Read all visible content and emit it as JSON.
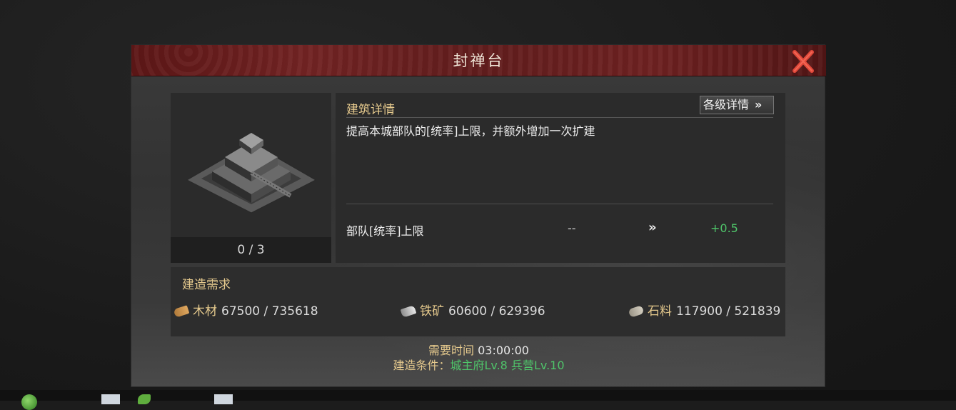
{
  "dialog": {
    "title": "封禅台",
    "close_icon": "close-x-icon",
    "colors": {
      "header_red": "#6e2222",
      "close_red": "#d94a3c",
      "gold_text": "#e5c98d",
      "green_text": "#4fc56a"
    }
  },
  "building": {
    "image": "building-altar-image",
    "count": "0 / 3"
  },
  "details": {
    "section_title": "建筑详情",
    "levels_button": "各级详情",
    "levels_button_icon": "double-chevron-right-icon",
    "description": "提高本城部队的[统率]上限，并额外增加一次扩建",
    "stat": {
      "label": "部队[统率]上限",
      "current": "--",
      "arrow": "»",
      "next": "+0.5"
    }
  },
  "requirements": {
    "title": "建造需求",
    "resources": [
      {
        "icon": "wood-icon",
        "name": "木材",
        "value": "67500 / 735618"
      },
      {
        "icon": "iron-ore-icon",
        "name": "铁矿",
        "value": "60600 / 629396"
      },
      {
        "icon": "stone-icon",
        "name": "石料",
        "value": "117900 / 521839"
      }
    ]
  },
  "footer": {
    "time_label": "需要时间",
    "time_value": "03:00:00",
    "condition_label": "建造条件：",
    "condition_value": "城主府Lv.8  兵营Lv.10"
  }
}
